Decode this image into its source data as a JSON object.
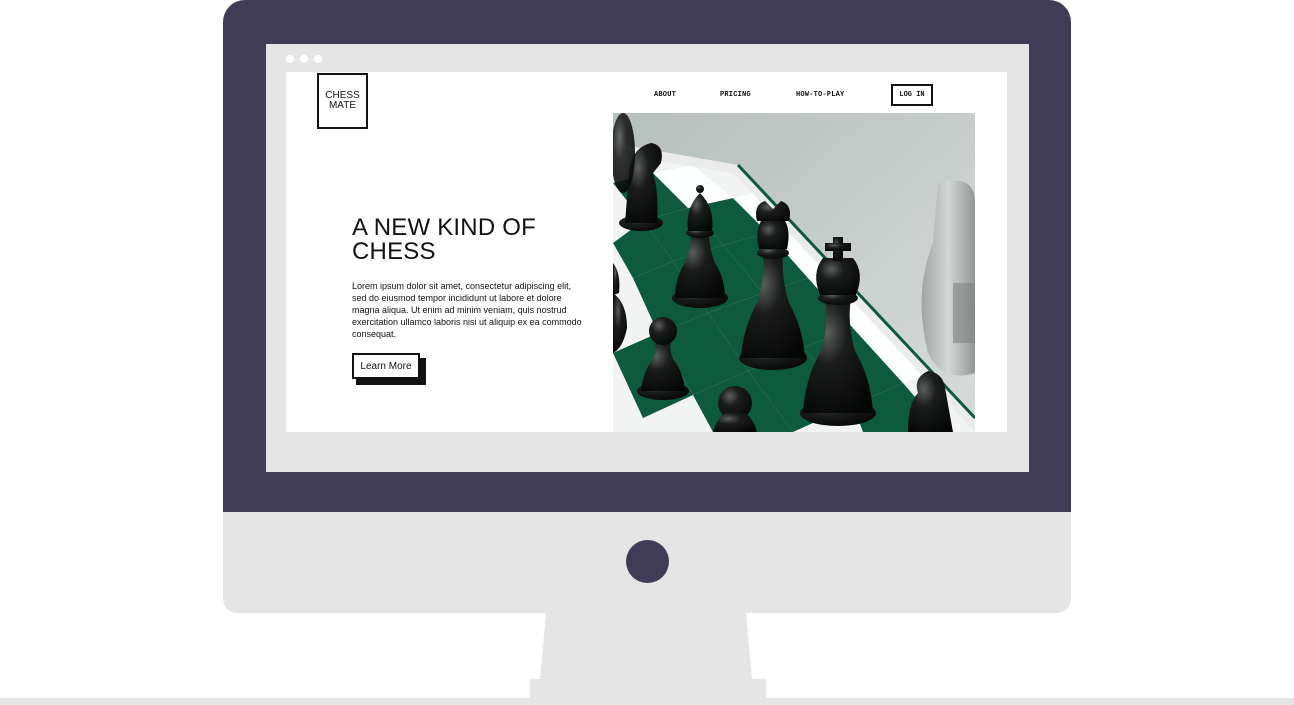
{
  "page": {
    "logo": {
      "line1": "CHESS",
      "line2": "MATE"
    },
    "nav": {
      "items": [
        {
          "label": "ABOUT"
        },
        {
          "label": "PRICING"
        },
        {
          "label": "HOW-TO-PLAY"
        }
      ],
      "login_label": "LOG IN"
    },
    "hero": {
      "title": "A NEW KIND OF CHESS",
      "body": "Lorem ipsum dolor sit amet, consectetur adipiscing elit, sed do eiusmod tempor incididunt ut labore et dolore magna aliqua. Ut enim ad minim veniam, quis nostrud exercitation ullamco laboris nisi ut aliquip ex ea commodo consequat.",
      "cta_label": "Learn More",
      "image": "chess-pieces-photo"
    }
  },
  "colors": {
    "monitor_bezel": "#403c55",
    "monitor_chin": "#e5e5e5",
    "page_background": "#ffffff",
    "text": "#111111",
    "board_green": "#0d5a3c"
  }
}
